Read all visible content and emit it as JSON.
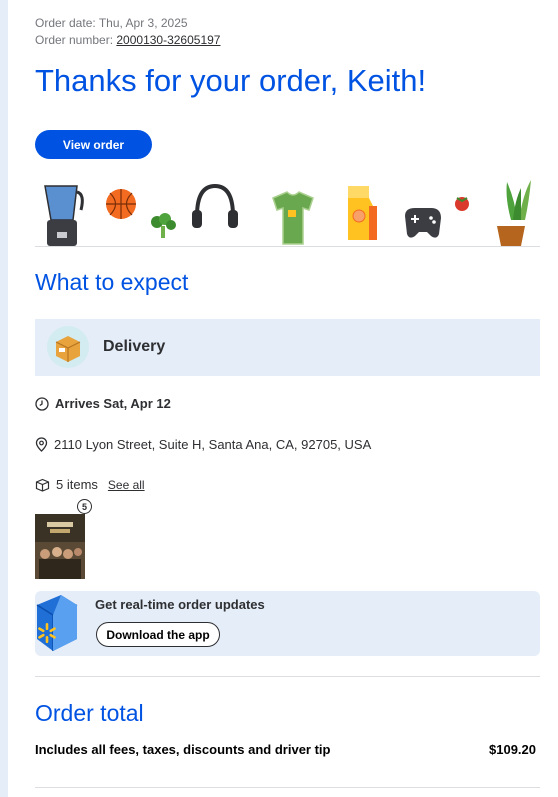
{
  "order": {
    "date_label": "Order date:",
    "date": "Thu, Apr 3, 2025",
    "number_label": "Order number:",
    "number": "2000130-32605197"
  },
  "header": {
    "thanks": "Thanks for your order, Keith!",
    "view_order_label": "View order"
  },
  "expect": {
    "title": "What to expect",
    "method": "Delivery",
    "arrives": "Arrives Sat, Apr 12",
    "address": "2110 Lyon Street, Suite H, Santa Ana, CA, 92705, USA",
    "items_count": "5 items",
    "see_all": "See all",
    "qty_badge": "5"
  },
  "updates": {
    "title": "Get real-time order updates",
    "download_label": "Download the app"
  },
  "total": {
    "title": "Order total",
    "note": "Includes all fees, taxes, discounts and driver tip",
    "amount": "$109.20"
  },
  "colors": {
    "brand_blue": "#0053e2",
    "band_blue": "#e5edf8",
    "spark_yellow": "#ffc220"
  }
}
